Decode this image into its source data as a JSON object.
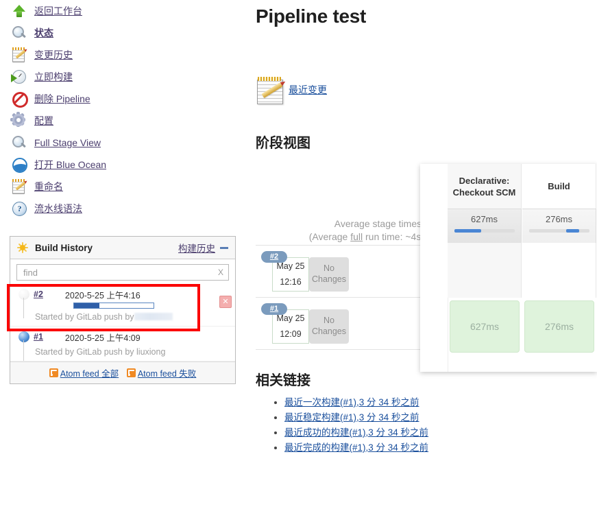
{
  "sidebar": {
    "items": [
      {
        "label": "返回工作台",
        "icon": "arrow-up-icon",
        "current": false
      },
      {
        "label": "状态",
        "icon": "search-icon",
        "current": true
      },
      {
        "label": "变更历史",
        "icon": "notepad-pencil-icon",
        "current": false
      },
      {
        "label": "立即构建",
        "icon": "build-now-clock-icon",
        "current": false
      },
      {
        "label": "删除 Pipeline",
        "icon": "delete-forbidden-icon",
        "current": false
      },
      {
        "label": "配置",
        "icon": "gear-icon",
        "current": false
      },
      {
        "label": "Full Stage View",
        "icon": "search-icon",
        "current": false
      },
      {
        "label": "打开 Blue Ocean",
        "icon": "blue-ocean-icon",
        "current": false
      },
      {
        "label": "重命名",
        "icon": "notepad-pencil-icon",
        "current": false
      },
      {
        "label": "流水线语法",
        "icon": "help-question-icon",
        "current": false
      }
    ]
  },
  "build_history": {
    "title": "Build History",
    "localized_title": "构建历史",
    "search": {
      "placeholder": "find",
      "value": "",
      "clear_label": "X"
    },
    "builds": [
      {
        "number": "#2",
        "timestamp": "2020-5-25 上午4:16",
        "cause_prefix": "Started by GitLab push by",
        "cause_user": "",
        "user_redacted": true,
        "status": "in-progress",
        "progress_percent": 32,
        "has_delete_button": true
      },
      {
        "number": "#1",
        "timestamp": "2020-5-25 上午4:09",
        "cause_prefix": "Started by GitLab push by",
        "cause_user": "liuxiong",
        "user_redacted": false,
        "status": "success",
        "progress_percent": 0,
        "has_delete_button": false
      }
    ],
    "feeds": [
      {
        "label": "Atom feed 全部"
      },
      {
        "label": "Atom feed 失败"
      }
    ]
  },
  "main": {
    "page_title": "Pipeline test",
    "changes_link": "最近变更",
    "stage_view_heading": "阶段视图",
    "related_links_heading": "相关链接",
    "average_line1": "Average stage times:",
    "average_line2_pre": "(Average ",
    "average_line2_mid": "full",
    "average_line2_post": " run time: ~4s)",
    "related_links": [
      "最近一次构建(#1),3 分 34 秒之前",
      "最近稳定构建(#1),3 分 34 秒之前",
      "最近成功的构建(#1),3 分 34 秒之前",
      "最近完成的构建(#1),3 分 34 秒之前"
    ]
  },
  "stage_view": {
    "stages": [
      {
        "name": "Declarative: Checkout SCM",
        "average": "627ms",
        "bar_start_percent": 0,
        "bar_width_percent": 45
      },
      {
        "name": "Build",
        "average": "276ms",
        "bar_start_percent": 62,
        "bar_width_percent": 22
      }
    ],
    "runs": [
      {
        "number": "#2",
        "date": "May 25",
        "time": "12:16",
        "changes": "No Changes",
        "cells": [
          {
            "value": "",
            "state": "empty"
          },
          {
            "value": "",
            "state": "empty"
          }
        ]
      },
      {
        "number": "#1",
        "date": "May 25",
        "time": "12:09",
        "changes": "No Changes",
        "cells": [
          {
            "value": "627ms",
            "state": "success"
          },
          {
            "value": "276ms",
            "state": "success"
          }
        ]
      }
    ]
  },
  "annotation": {
    "highlight_color": "#fb0000",
    "target": "build-history-row-2"
  }
}
